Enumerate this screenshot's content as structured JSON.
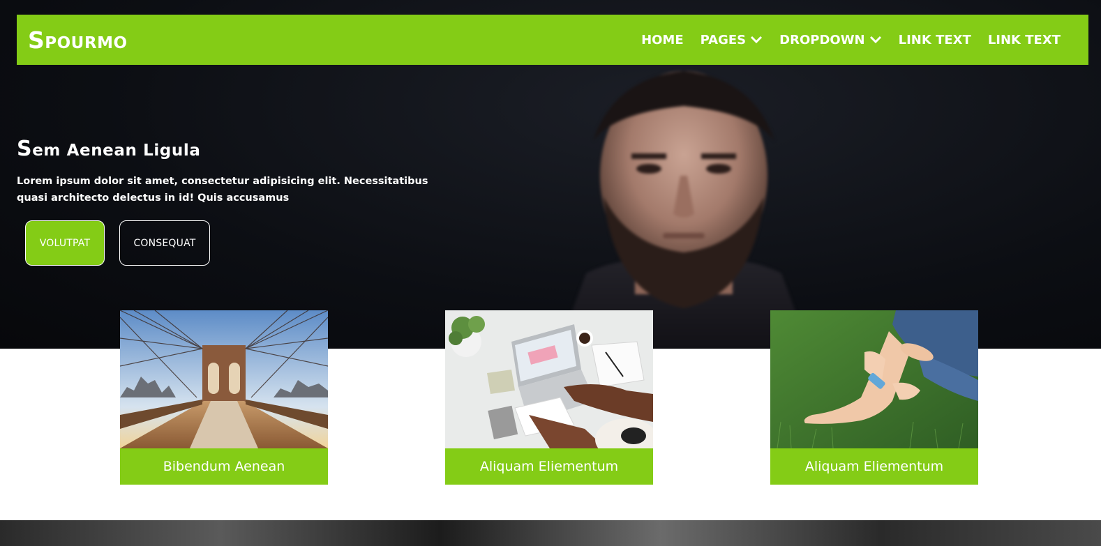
{
  "navbar": {
    "brand": "Spourmo",
    "items": [
      {
        "label": "HOME",
        "dropdown": false
      },
      {
        "label": "PAGES",
        "dropdown": true
      },
      {
        "label": "DROPDOWN",
        "dropdown": true
      },
      {
        "label": "LINK TEXT",
        "dropdown": false
      },
      {
        "label": "LINK TEXT",
        "dropdown": false
      }
    ]
  },
  "hero": {
    "title_first": "S",
    "title_rest": "em Aenean Ligula",
    "text": "Lorem ipsum dolor sit amet, consectetur adipisicing elit. Necessitatibus quasi architecto delectus in id! Quis accusamus",
    "primary_button": "VOLUTPAT",
    "secondary_button": "CONSEQUAT"
  },
  "cards": [
    {
      "caption": "Bibendum Aenean",
      "image": "bridge-photo"
    },
    {
      "caption": "Aliquam Eliementum",
      "image": "desk-laptop-photo"
    },
    {
      "caption": "Aliquam Eliementum",
      "image": "barefoot-grass-photo"
    }
  ],
  "colors": {
    "accent": "#84cc16",
    "hero_bg": "#0c0e13",
    "text_light": "#ffffff"
  }
}
